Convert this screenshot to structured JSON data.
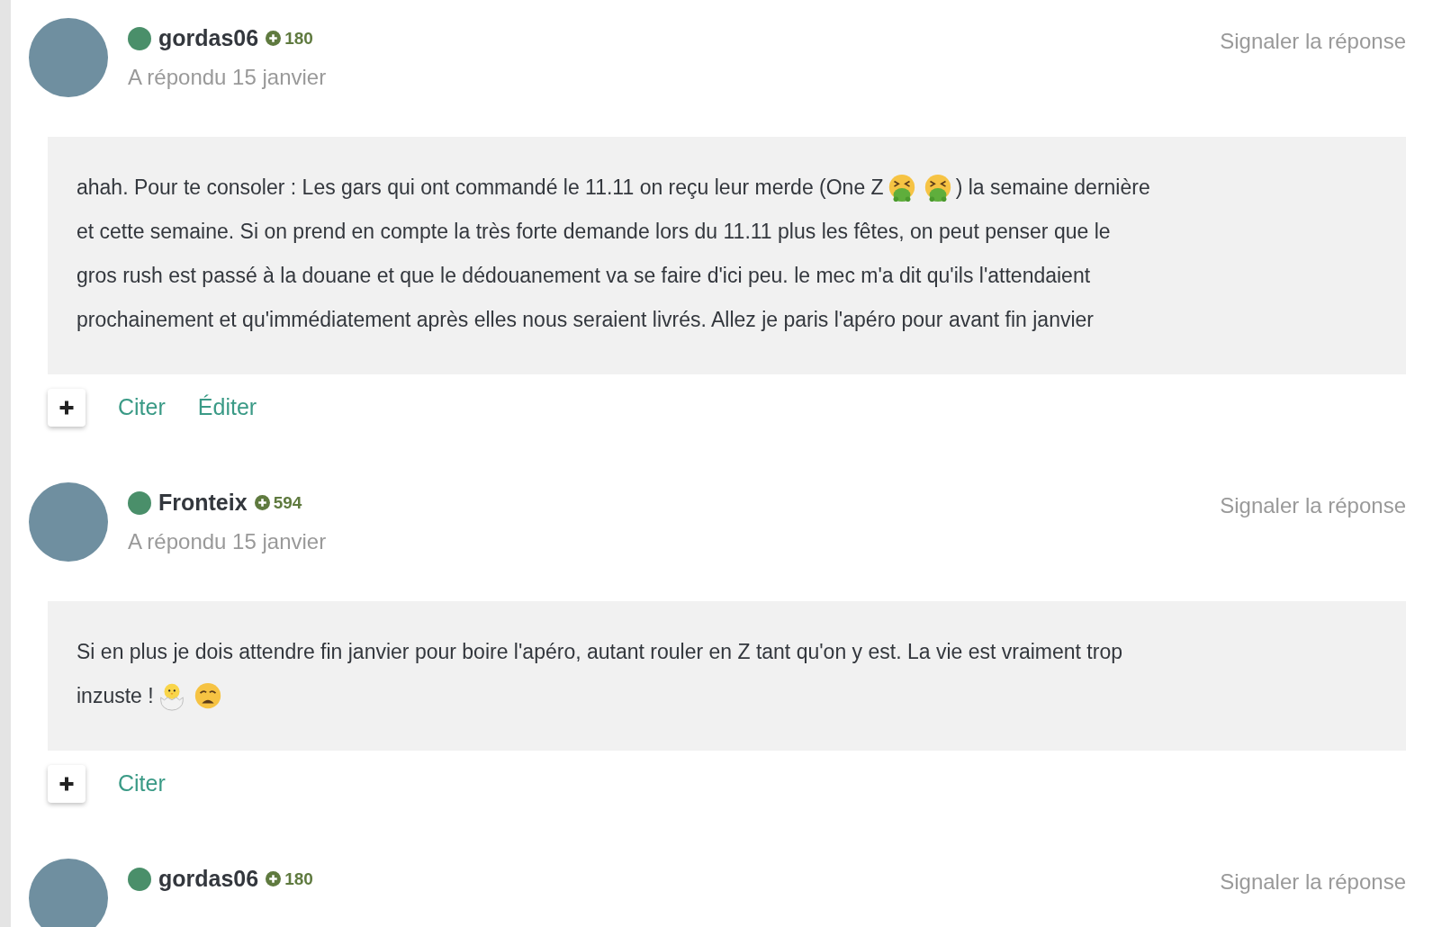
{
  "posts": [
    {
      "author": "gordas06",
      "online": true,
      "score": "180",
      "date": "A répondu 15 janvier",
      "report": "Signaler la réponse",
      "body": [
        [
          {
            "kind": "text",
            "text": "ahah. Pour te consoler : Les gars qui ont commandé le 11.11 on reçu leur merde (One Z"
          },
          {
            "kind": "nauseated"
          },
          {
            "kind": "nauseated"
          },
          {
            "kind": "text",
            "text": ") la semaine dernière"
          }
        ],
        [
          {
            "kind": "text",
            "text": "et cette semaine. Si on prend en compte la très forte demande lors du 11.11 plus les fêtes, on peut penser que le"
          }
        ],
        [
          {
            "kind": "text",
            "text": "gros rush est passé à la douane et que le dédouanement va se faire d'ici peu. le mec m'a dit qu'ils l'attendaient"
          }
        ],
        [
          {
            "kind": "text",
            "text": "prochainement et qu'immédiatement après elles nous seraient livrés. Allez je paris l'apéro pour avant fin janvier"
          }
        ]
      ],
      "actions": [
        "Citer",
        "Éditer"
      ]
    },
    {
      "author": "Fronteix",
      "online": true,
      "score": "594",
      "date": "A répondu 15 janvier",
      "report": "Signaler la réponse",
      "body": [
        [
          {
            "kind": "text",
            "text": "Si en plus je dois attendre fin janvier pour boire l'apéro, autant rouler en Z tant qu'on y est. La vie est vraiment trop"
          }
        ],
        [
          {
            "kind": "text",
            "text": "inzuste !"
          },
          {
            "kind": "chick"
          },
          {
            "kind": "weary"
          }
        ]
      ],
      "actions": [
        "Citer"
      ]
    },
    {
      "author": "gordas06",
      "online": true,
      "score": "180",
      "report": "Signaler la réponse"
    }
  ]
}
